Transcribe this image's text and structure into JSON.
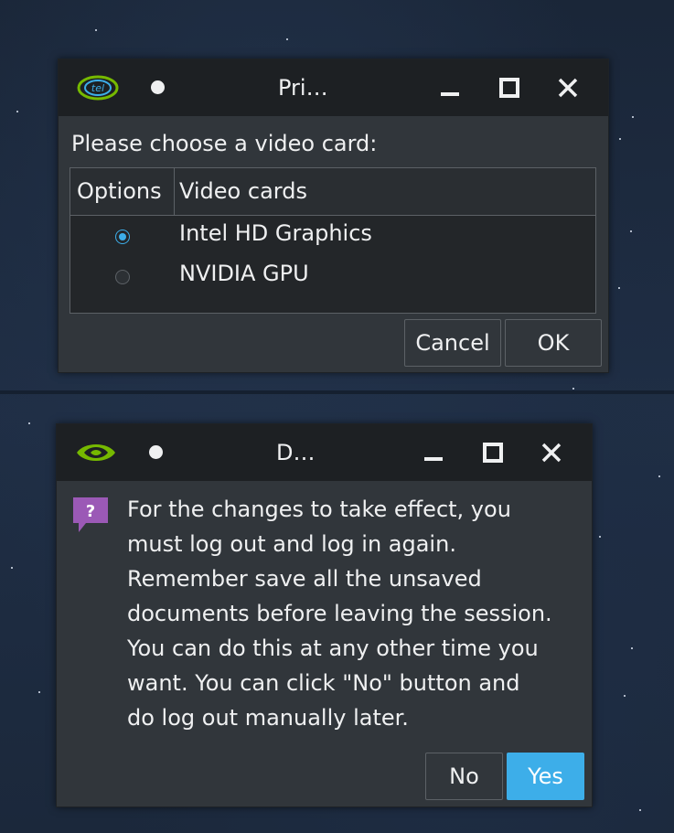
{
  "dialog1": {
    "title": "Pri…",
    "prompt": "Please choose a video card:",
    "columns": [
      "Options",
      "Video cards"
    ],
    "rows": [
      {
        "label": "Intel HD Graphics",
        "selected": true
      },
      {
        "label": "NVIDIA GPU",
        "selected": false
      }
    ],
    "cancel_label": "Cancel",
    "ok_label": "OK",
    "icon": "intel-logo-icon"
  },
  "dialog2": {
    "title": "D…",
    "message": "For the changes to take effect, you\nmust log out and log in again.\nRemember save all the unsaved\ndocuments before leaving the session.\nYou can do this at any other time you\nwant. You can click \"No\" button and\ndo log out manually later.",
    "no_label": "No",
    "yes_label": "Yes",
    "icon": "nvidia-logo-icon",
    "message_icon": "question-icon",
    "question_glyph": "?"
  },
  "colors": {
    "accent": "#3daee9",
    "window_bg": "#31363b",
    "titlebar_bg": "#1d2023",
    "nvidia_green": "#76b900",
    "question_purple": "#9b59b6"
  }
}
